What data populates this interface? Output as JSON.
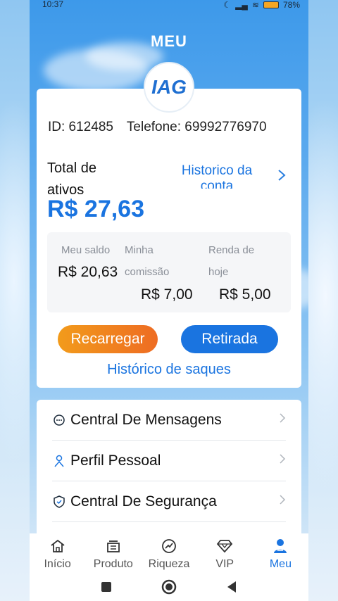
{
  "status_bar": {
    "time": "10:37",
    "battery": "78%"
  },
  "header": {
    "title": "MEU",
    "logo_text": "IAG"
  },
  "account": {
    "id_text": "ID: 612485",
    "phone_text": "Telefone: 69992776970",
    "total_label": "Total de ativos",
    "total_value": "R$ 27,63",
    "history_link": "Historico da conta",
    "stats": {
      "balance_label": "Meu saldo",
      "balance_value": "R$ 20,63",
      "commission_label": "Minha comissão",
      "commission_value": "R$ 7,00",
      "income_label": "Renda de hoje",
      "income_value": "R$ 5,00"
    },
    "recharge_label": "Recarregar",
    "withdraw_label": "Retirada",
    "withdraw_history_label": "Histórico de saques"
  },
  "menu": {
    "items": [
      {
        "label": "Central De Mensagens",
        "icon": "message-icon"
      },
      {
        "label": "Perfil Pessoal",
        "icon": "person-icon"
      },
      {
        "label": "Central De Segurança",
        "icon": "shield-icon"
      }
    ]
  },
  "tabbar": {
    "items": [
      {
        "label": "Início",
        "icon": "home-icon"
      },
      {
        "label": "Produto",
        "icon": "product-icon"
      },
      {
        "label": "Riqueza",
        "icon": "wealth-icon"
      },
      {
        "label": "VIP",
        "icon": "diamond-icon"
      },
      {
        "label": "Meu",
        "icon": "user-icon",
        "active": true
      }
    ]
  },
  "colors": {
    "accent": "#1a74e0",
    "orange": "#ee6c23"
  }
}
